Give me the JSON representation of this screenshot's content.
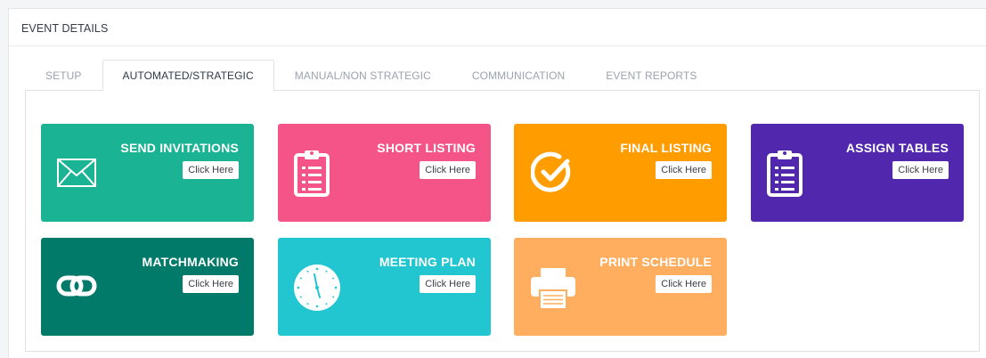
{
  "panel": {
    "title": "EVENT DETAILS"
  },
  "tabs": [
    {
      "label": "SETUP"
    },
    {
      "label": "AUTOMATED/STRATEGIC"
    },
    {
      "label": "MANUAL/NON STRATEGIC"
    },
    {
      "label": "COMMUNICATION"
    },
    {
      "label": "EVENT REPORTS"
    }
  ],
  "active_tab": "AUTOMATED/STRATEGIC",
  "tiles": [
    {
      "title": "SEND INVITATIONS",
      "button": "Click Here",
      "color": "#1ab394",
      "icon": "envelope-icon"
    },
    {
      "title": "SHORT LISTING",
      "button": "Click Here",
      "color": "#f55489",
      "icon": "clipboard-icon"
    },
    {
      "title": "FINAL LISTING",
      "button": "Click Here",
      "color": "#ff9c00",
      "icon": "check-circle-icon"
    },
    {
      "title": "ASSIGN TABLES",
      "button": "Click Here",
      "color": "#5128ad",
      "icon": "clipboard-icon"
    },
    {
      "title": "MATCHMAKING",
      "button": "Click Here",
      "color": "#027a69",
      "icon": "link-icon"
    },
    {
      "title": "MEETING PLAN",
      "button": "Click Here",
      "color": "#22c6d0",
      "icon": "clock-icon"
    },
    {
      "title": "PRINT SCHEDULE",
      "button": "Click Here",
      "color": "#ffad5e",
      "icon": "printer-icon"
    }
  ]
}
